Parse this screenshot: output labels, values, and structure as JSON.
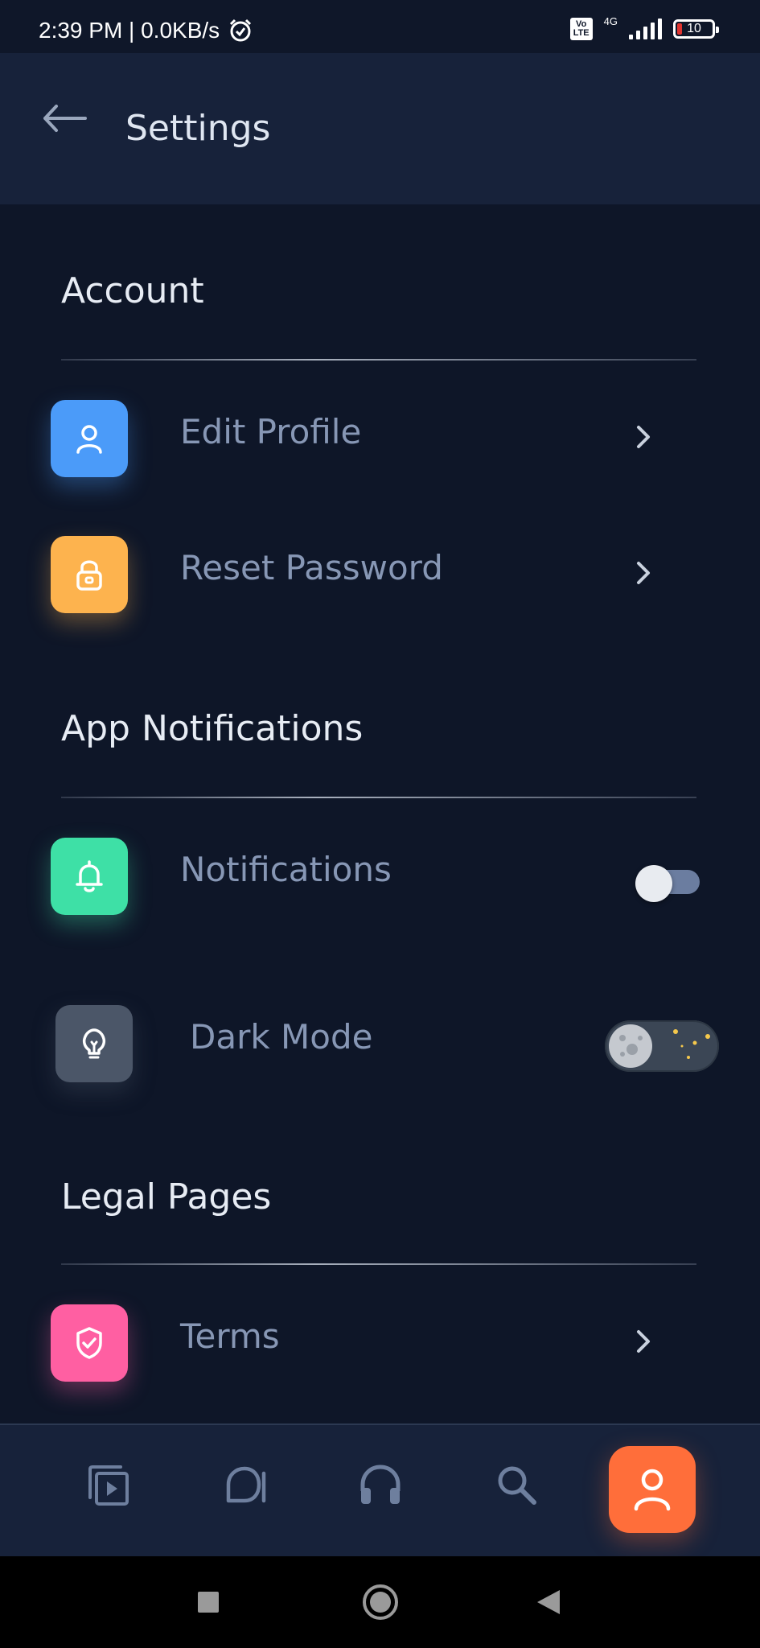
{
  "status_bar": {
    "time_speed": "2:39 PM | 0.0KB/s",
    "volte": "Vo\nLTE",
    "network": "4G",
    "battery_level": "10",
    "battery_color": "#e0342f"
  },
  "header": {
    "title": "Settings",
    "back_icon": "arrow-left-icon"
  },
  "sections": {
    "account": {
      "title": "Account",
      "items": [
        {
          "label": "Edit Profile",
          "icon": "user-icon",
          "color": "#4b9bf9"
        },
        {
          "label": "Reset Password",
          "icon": "lock-icon",
          "color": "#fdb34e"
        }
      ]
    },
    "notifications": {
      "title": "App Notifications",
      "items": [
        {
          "label": "Notifications",
          "icon": "bell-icon",
          "color": "#3ee0a6",
          "toggle": "off"
        },
        {
          "label": "Dark Mode",
          "icon": "lightbulb-icon",
          "color": "#4b5668",
          "toggle": "on"
        }
      ]
    },
    "legal": {
      "title": "Legal Pages",
      "items": [
        {
          "label": "Terms",
          "icon": "shield-check-icon",
          "color": "#ff5fa2"
        }
      ]
    }
  },
  "bottom_nav": {
    "items": [
      {
        "icon": "video-library-icon"
      },
      {
        "icon": "chat-bubble-icon"
      },
      {
        "icon": "headphones-icon"
      },
      {
        "icon": "search-icon"
      },
      {
        "icon": "user-icon",
        "active": true,
        "color": "#ff6e3a"
      }
    ]
  },
  "colors": {
    "background": "#0e1628",
    "header_bg": "#17223a",
    "label_color": "#8797b5"
  }
}
